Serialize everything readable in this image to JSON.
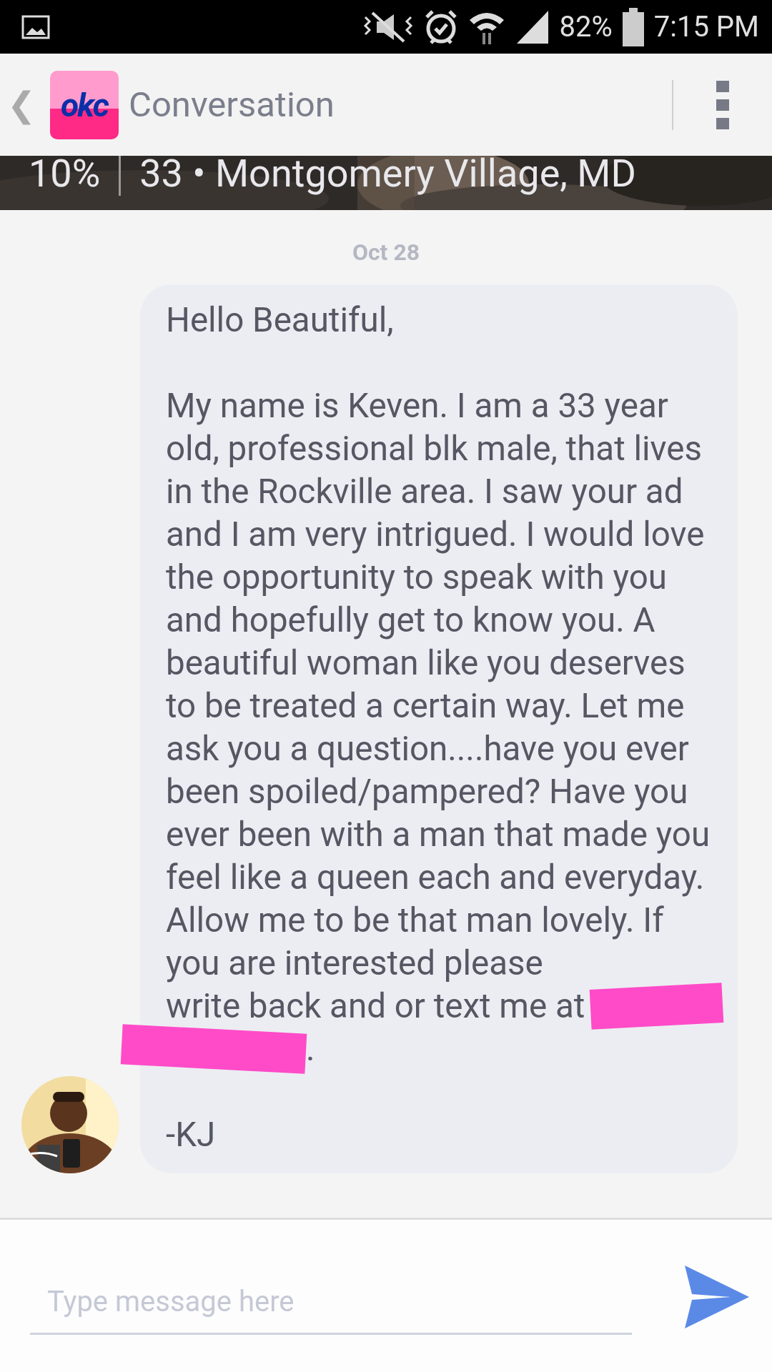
{
  "status_bar": {
    "battery": "82%",
    "time": "7:15 PM"
  },
  "app_bar": {
    "back": "❮",
    "logo": "okc",
    "title": "Conversation"
  },
  "profile_banner": {
    "match": "10%",
    "details": "33 • Montgomery Village, MD"
  },
  "conversation": {
    "date": "Oct 28",
    "message": {
      "greeting": "Hello Beautiful,",
      "body": "My name is Keven. I am a 33 year old, professional blk male, that lives in the Rockville area. I saw your ad and I am very intrigued. I would love the opportunity to speak with you and hopefully get to know you. A beautiful woman like you deserves to be treated a certain way. Let me ask you a question....have you ever been spoiled/pampered? Have you ever been with a man that made you feel like a queen each and everyday. Allow me to be that man lovely. If you are interested please",
      "body_line_end": "write back and or text me at",
      "body_end": ".",
      "signature": "-KJ"
    }
  },
  "composer": {
    "placeholder": "Type message here"
  }
}
